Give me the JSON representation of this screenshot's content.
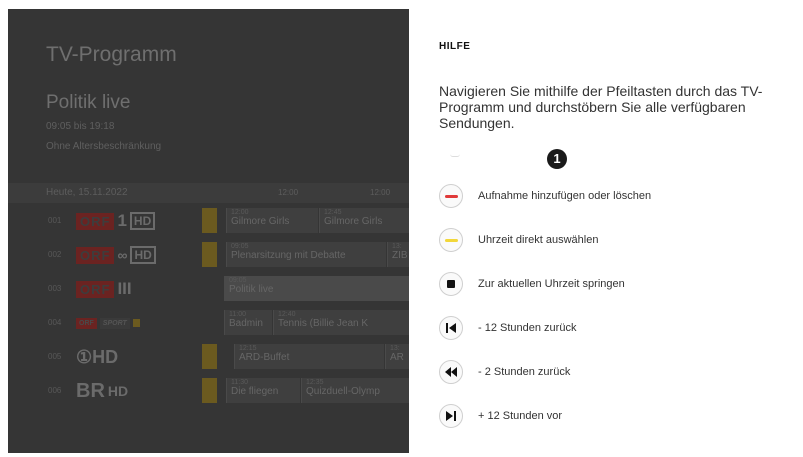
{
  "guide": {
    "title": "TV-Programm",
    "selected_show": {
      "title": "Politik live",
      "time": "09:05 bis 19:18",
      "rating": "Ohne Altersbeschränkung"
    },
    "timebar": {
      "date": "Heute, 15.11.2022",
      "times": [
        "12:00",
        "12:00"
      ]
    },
    "channels": [
      {
        "num": "001",
        "logo_text": "ORF",
        "logo_suffix": "1",
        "hd": "HD",
        "slots": [
          {
            "time": "12:00",
            "name": "Gilmore Girls"
          },
          {
            "time": "12:45",
            "name": "Gilmore Girls"
          }
        ]
      },
      {
        "num": "002",
        "logo_text": "ORF",
        "logo_suffix": "∞",
        "hd": "HD",
        "slots": [
          {
            "time": "09:05",
            "name": "Plenarsitzung mit Debatte"
          },
          {
            "time": "13:",
            "name": "ZIB"
          }
        ]
      },
      {
        "num": "003",
        "logo_text": "ORF",
        "logo_suffix": "III",
        "slots": [
          {
            "time": "09:05",
            "name": "Politik live"
          }
        ]
      },
      {
        "num": "004",
        "logo_text": "ORF",
        "logo_suffix": "SPORT",
        "slots": [
          {
            "time": "11:00",
            "name": "Badmin"
          },
          {
            "time": "12:40",
            "name": "Tennis (Billie Jean K"
          }
        ]
      },
      {
        "num": "005",
        "logo_text": "①HD",
        "slots": [
          {
            "time": "12:15",
            "name": "ARD-Buffet"
          },
          {
            "time": "13:",
            "name": "AR"
          }
        ]
      },
      {
        "num": "006",
        "logo_text": "BR",
        "logo_suffix": "HD",
        "slots": [
          {
            "time": "11:30",
            "name": "Die fliegen"
          },
          {
            "time": "12:35",
            "name": "Quizduell-Olymp"
          }
        ]
      }
    ]
  },
  "help": {
    "header": "HILFE",
    "intro": "Navigieren Sie mithilfe der Pfeiltasten durch das TV-Programm und durchstöbern Sie alle verfügbaren Sendungen.",
    "badge": "1",
    "items": [
      {
        "icon": "red-key-icon",
        "color": "#e03a3a",
        "label": "Aufnahme hinzufügen oder löschen"
      },
      {
        "icon": "yellow-key-icon",
        "color": "#f2d73a",
        "label": "Uhrzeit direkt auswählen"
      },
      {
        "icon": "stop-icon",
        "label": "Zur aktuellen Uhrzeit springen"
      },
      {
        "icon": "skip-back-icon",
        "label": "- 12 Stunden zurück"
      },
      {
        "icon": "rewind-icon",
        "label": "- 2 Stunden zurück"
      },
      {
        "icon": "skip-forward-icon",
        "label": "+ 12 Stunden vor"
      }
    ]
  }
}
